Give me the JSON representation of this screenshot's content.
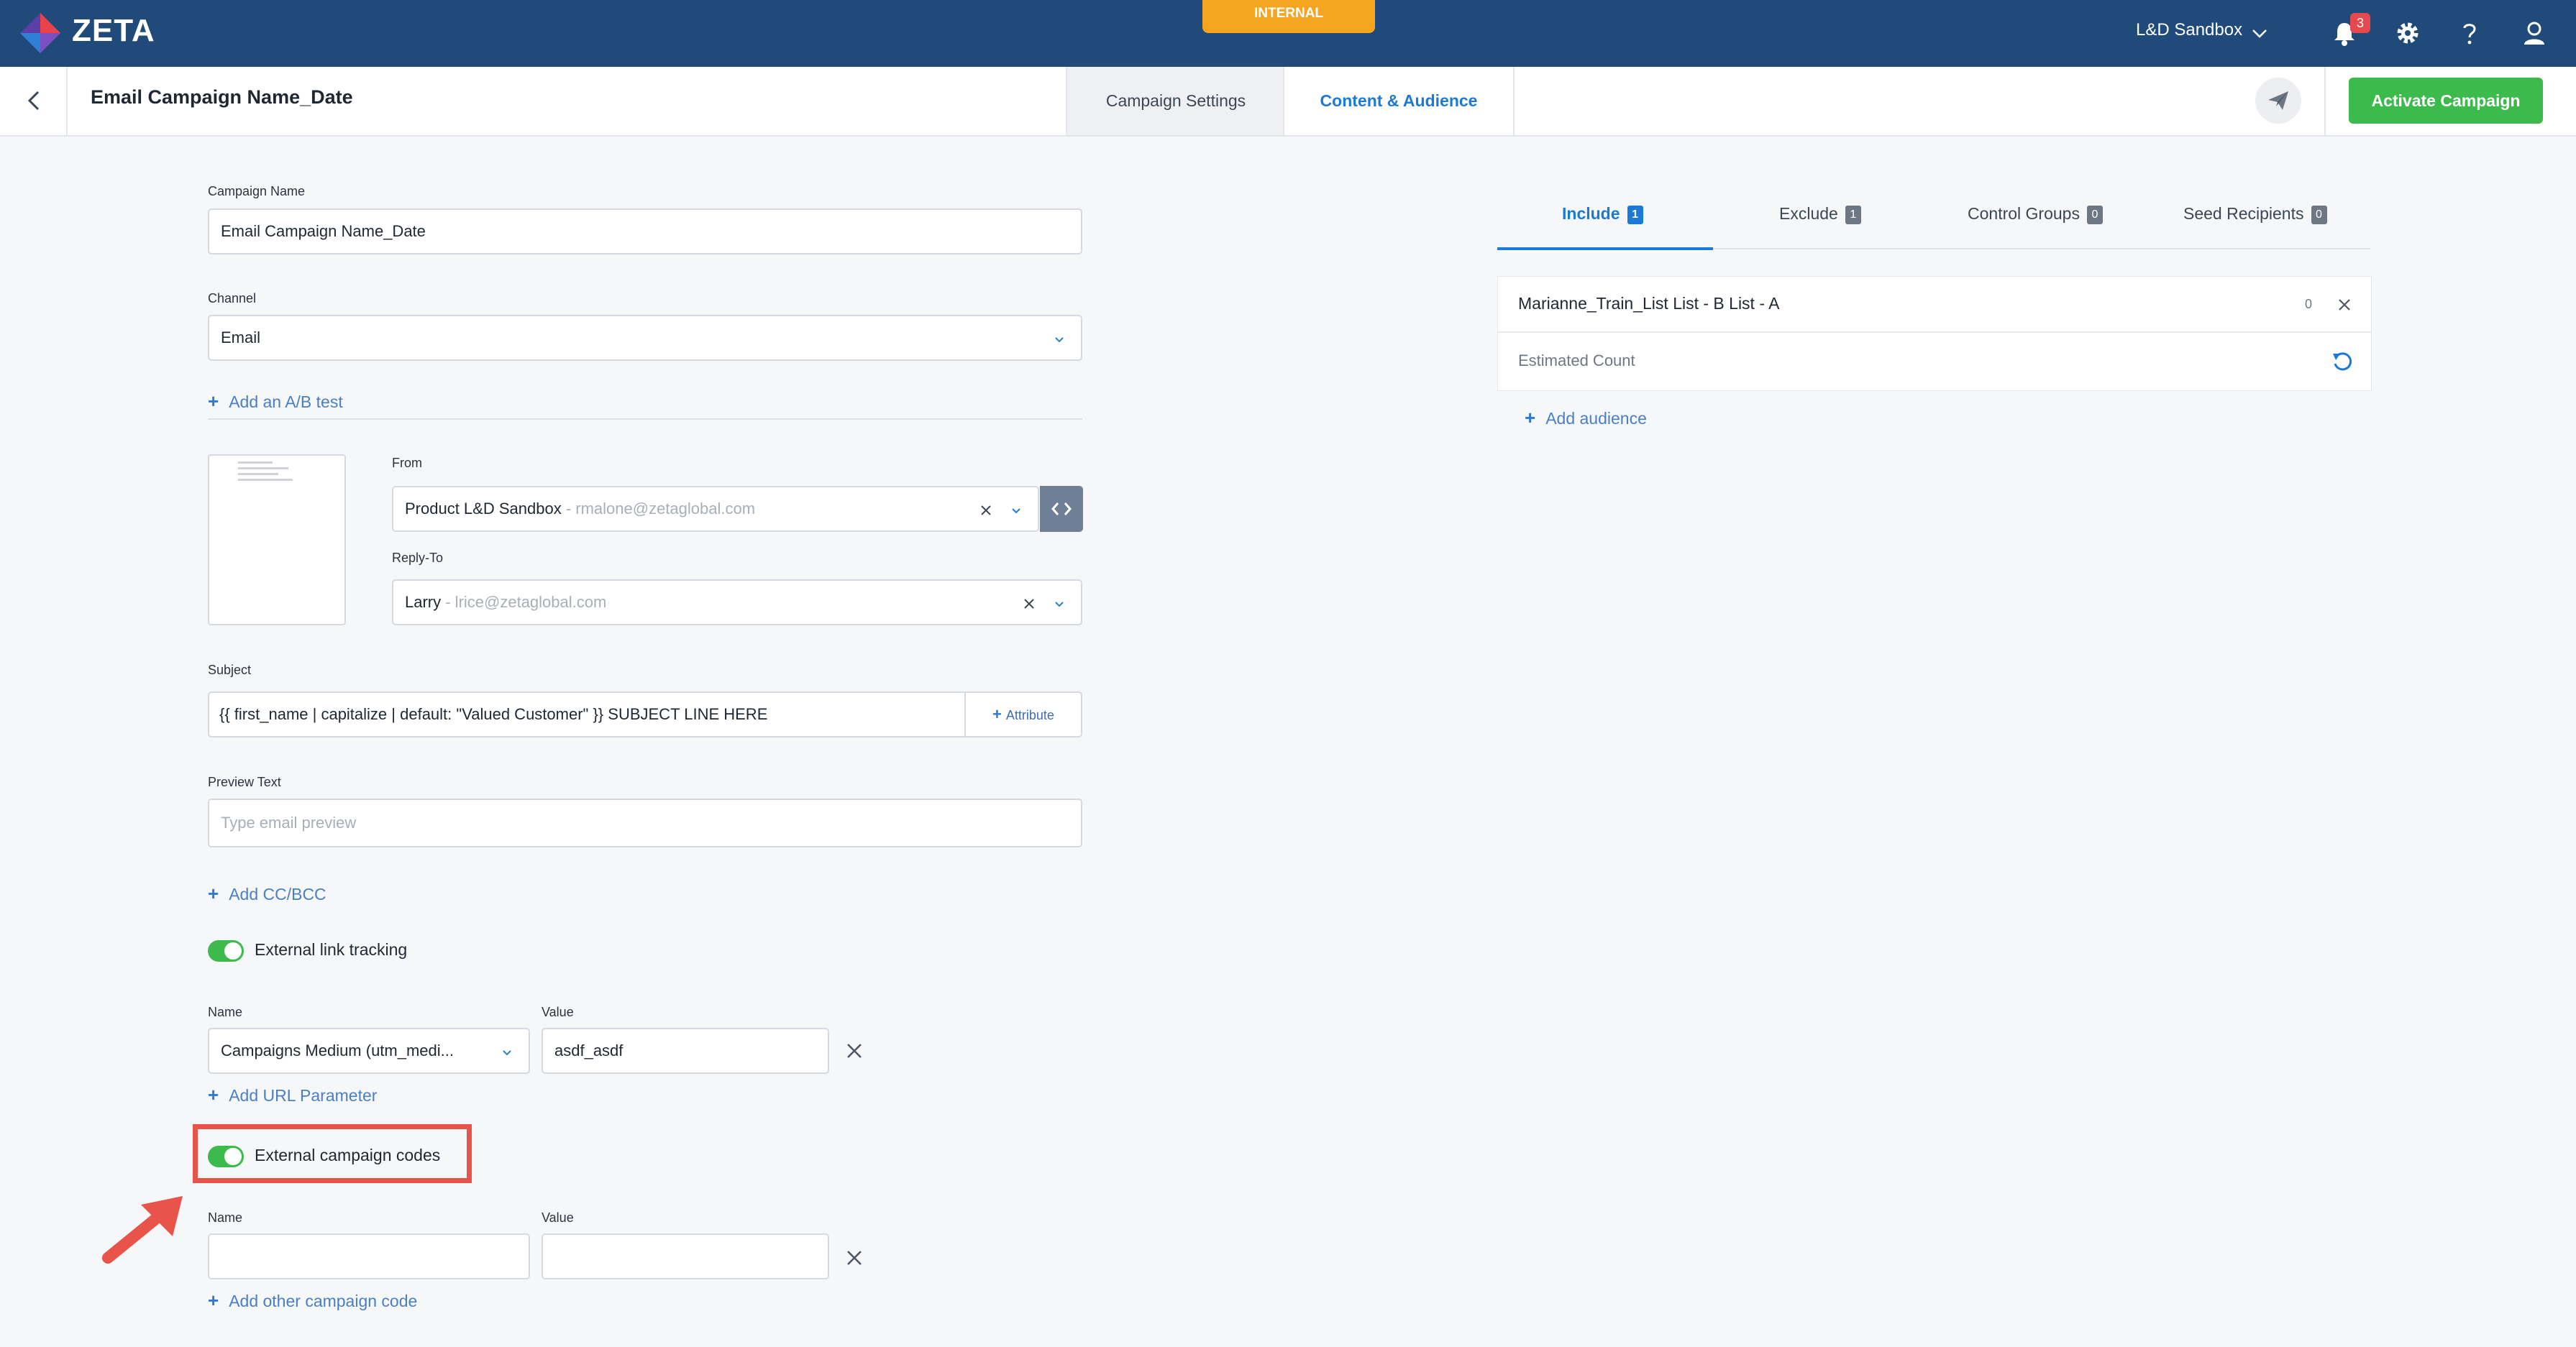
{
  "app": {
    "logo_text": "ZETA",
    "env_badge": "INTERNAL",
    "org_selector": "L&D Sandbox",
    "notifications_count": "3"
  },
  "header": {
    "title": "Email Campaign Name_Date",
    "tabs": [
      "Campaign Settings",
      "Content & Audience"
    ],
    "active_tab": "Content & Audience",
    "activate_label": "Activate Campaign"
  },
  "form": {
    "campaign_name": {
      "label": "Campaign Name",
      "value": "Email Campaign Name_Date"
    },
    "channel": {
      "label": "Channel",
      "value": "Email"
    },
    "ab_test_link": "Add an A/B test",
    "from": {
      "label": "From",
      "name": "Product L&D Sandbox",
      "email": " - rmalone@zetaglobal.com"
    },
    "reply_to": {
      "label": "Reply-To",
      "name": "Larry",
      "email": " - lrice@zetaglobal.com"
    },
    "subject": {
      "label": "Subject",
      "value": "{{ first_name | capitalize | default: \"Valued Customer\" }} SUBJECT LINE HERE",
      "attribute_button": "Attribute"
    },
    "preview_text": {
      "label": "Preview Text",
      "placeholder": "Type email preview"
    },
    "cc_bcc_link": "Add CC/BCC",
    "link_tracking": {
      "toggle_label": "External link tracking",
      "enabled": true,
      "name_label": "Name",
      "value_label": "Value",
      "param_name": "Campaigns Medium (utm_medi...",
      "param_value": "asdf_asdf",
      "add_param_link": "Add URL Parameter"
    },
    "campaign_codes": {
      "toggle_label": "External campaign codes",
      "enabled": true,
      "name_label": "Name",
      "value_label": "Value",
      "code_name": "",
      "code_value": "",
      "add_code_link": "Add other campaign code"
    }
  },
  "audience": {
    "tabs": [
      {
        "label": "Include",
        "count": "1"
      },
      {
        "label": "Exclude",
        "count": "1"
      },
      {
        "label": "Control Groups",
        "count": "0"
      },
      {
        "label": "Seed Recipients",
        "count": "0"
      }
    ],
    "active_tab": "Include",
    "list_name": "Marianne_Train_List List - B List - A",
    "list_count": "0",
    "estimated_count_label": "Estimated Count",
    "add_audience_link": "Add audience"
  },
  "colors": {
    "topbar": "#1f4a7a",
    "accent": "#1a7ad6",
    "activate": "#3cba4b",
    "toggle_on": "#3cba4b",
    "internal_badge": "#f4a623",
    "annotation": "#e8534a"
  }
}
